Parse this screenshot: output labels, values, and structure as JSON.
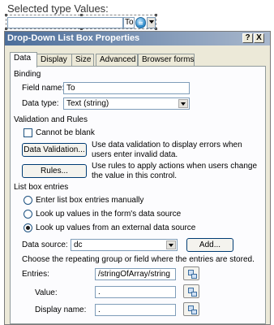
{
  "form": {
    "label": "Selected type Values:",
    "control_value": "To"
  },
  "dialog": {
    "title": "Drop-Down List Box Properties",
    "help_glyph": "?",
    "close_glyph": "X",
    "tabs": [
      {
        "label": "Data"
      },
      {
        "label": "Display"
      },
      {
        "label": "Size"
      },
      {
        "label": "Advanced"
      },
      {
        "label": "Browser forms"
      }
    ]
  },
  "binding": {
    "header": "Binding",
    "field_name_label": "Field name:",
    "field_name_value": "To",
    "data_type_label": "Data type:",
    "data_type_value": "Text (string)"
  },
  "validation": {
    "header": "Validation and Rules",
    "cannot_be_blank_label": "Cannot be blank",
    "cannot_be_blank_checked": false,
    "data_validation_button": "Data Validation...",
    "data_validation_desc": "Use data validation to display errors when users enter invalid data.",
    "rules_button": "Rules...",
    "rules_desc": "Use rules to apply actions when users change the value in this control."
  },
  "entries": {
    "header": "List box entries",
    "options": [
      {
        "label": "Enter list box entries manually",
        "selected": false
      },
      {
        "label": "Look up values in the form's data source",
        "selected": false
      },
      {
        "label": "Look up values from an external data source",
        "selected": true
      }
    ],
    "data_source_label": "Data source:",
    "data_source_value": "dc",
    "add_button": "Add...",
    "instructions": "Choose the repeating group or field where the entries are stored.",
    "entries_label": "Entries:",
    "entries_value": "/stringOfArray/string",
    "value_label": "Value:",
    "value_value": ".",
    "display_name_label": "Display name:",
    "display_name_value": "."
  }
}
